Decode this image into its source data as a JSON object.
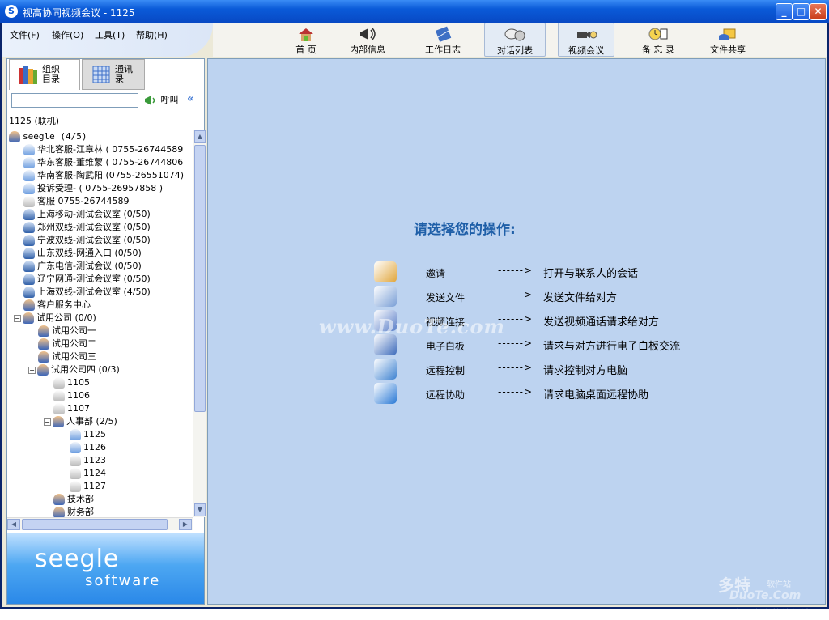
{
  "window": {
    "title": "视高协同视频会议 - 1125",
    "app_icon": "S"
  },
  "menu": {
    "items": [
      "文件(F)",
      "操作(O)",
      "工具(T)",
      "帮助(H)"
    ]
  },
  "toolbar": {
    "items": [
      {
        "label": "首 页",
        "icon": "house-icon"
      },
      {
        "label": "内部信息",
        "icon": "megaphone-icon"
      },
      {
        "label": "工作日志",
        "icon": "notebook-icon"
      },
      {
        "label": "对话列表",
        "icon": "chat-list-icon",
        "active": true
      },
      {
        "label": "视频会议",
        "icon": "video-camera-icon",
        "active": true
      },
      {
        "label": "备 忘 录",
        "icon": "memo-clock-icon"
      },
      {
        "label": "文件共享",
        "icon": "file-share-icon"
      }
    ]
  },
  "left_panel": {
    "tabs": [
      {
        "label": "组织目录",
        "icon": "books-icon"
      },
      {
        "label": "通讯录",
        "icon": "grid-icon"
      }
    ],
    "search": {
      "value": "",
      "placeholder": ""
    },
    "call_button": "呼叫",
    "status": "1125 (联机)",
    "tree": [
      {
        "label": "seegle (4/5)",
        "icon": "group",
        "level": 0,
        "mono": true
      },
      {
        "label": "华北客服-江章林 ( 0755-26744589",
        "icon": "person",
        "level": 1
      },
      {
        "label": "华东客服-董维蒙 ( 0755-26744806",
        "icon": "person",
        "level": 1
      },
      {
        "label": "华南客服-陶武阳 (0755-26551074)",
        "icon": "person",
        "level": 1
      },
      {
        "label": "投诉受理- ( 0755-26957858 )",
        "icon": "person",
        "level": 1
      },
      {
        "label": "客服  0755-26744589",
        "icon": "person-off",
        "level": 1
      },
      {
        "label": "上海移动-测试会议室 (0/50)",
        "icon": "room",
        "level": 1
      },
      {
        "label": "郑州双线-测试会议室 (0/50)",
        "icon": "room",
        "level": 1
      },
      {
        "label": "宁波双线-测试会议室 (0/50)",
        "icon": "room",
        "level": 1
      },
      {
        "label": "山东双线-网通入口 (0/50)",
        "icon": "room",
        "level": 1
      },
      {
        "label": "广东电信-测试会议 (0/50)",
        "icon": "room",
        "level": 1
      },
      {
        "label": "辽宁网通-测试会议室 (0/50)",
        "icon": "room",
        "level": 1
      },
      {
        "label": "上海双线-测试会议室 (4/50)",
        "icon": "room",
        "level": 1
      },
      {
        "label": "客户服务中心",
        "icon": "group",
        "level": 1
      },
      {
        "label": "试用公司 (0/0)",
        "icon": "group",
        "level": 1,
        "expander": "−"
      },
      {
        "label": "试用公司一",
        "icon": "group",
        "level": 2
      },
      {
        "label": "试用公司二",
        "icon": "group",
        "level": 2
      },
      {
        "label": "试用公司三",
        "icon": "group",
        "level": 2
      },
      {
        "label": "试用公司四 (0/3)",
        "icon": "group",
        "level": 2,
        "expander": "−"
      },
      {
        "label": "1105",
        "icon": "person-off",
        "level": 3
      },
      {
        "label": "1106",
        "icon": "person-off",
        "level": 3
      },
      {
        "label": "1107",
        "icon": "person-off",
        "level": 3
      },
      {
        "label": "人事部 (2/5)",
        "icon": "group",
        "level": 3,
        "expander": "−"
      },
      {
        "label": "1125",
        "icon": "person",
        "level": 4
      },
      {
        "label": "1126",
        "icon": "person",
        "level": 4
      },
      {
        "label": "1123",
        "icon": "person-off",
        "level": 4
      },
      {
        "label": "1124",
        "icon": "person-off",
        "level": 4
      },
      {
        "label": "1127",
        "icon": "person-off",
        "level": 4
      },
      {
        "label": "技术部",
        "icon": "group",
        "level": 3
      },
      {
        "label": "财务部",
        "icon": "group",
        "level": 3
      }
    ],
    "logo": {
      "line1": "seegle",
      "line2": "software"
    }
  },
  "main": {
    "prompt": "请选择您的操作:",
    "actions": [
      {
        "name": "邀请",
        "arrow": "------>",
        "desc": "打开与联系人的会话",
        "icon": "invite-icon",
        "color": "#e0a53a"
      },
      {
        "name": "发送文件",
        "arrow": "------>",
        "desc": "发送文件给对方",
        "icon": "send-file-icon",
        "color": "#7a9fd6"
      },
      {
        "name": "视频连接",
        "arrow": "------>",
        "desc": "发送视频通话请求给对方",
        "icon": "webcam-icon",
        "color": "#5b7fc8"
      },
      {
        "name": "电子白板",
        "arrow": "------>",
        "desc": "请求与对方进行电子白板交流",
        "icon": "whiteboard-icon",
        "color": "#3d6bbb"
      },
      {
        "name": "远程控制",
        "arrow": "------>",
        "desc": "请求控制对方电脑",
        "icon": "remote-control-icon",
        "color": "#3f83d1"
      },
      {
        "name": "远程协助",
        "arrow": "------>",
        "desc": "请求电脑桌面远程协助",
        "icon": "remote-assist-icon",
        "color": "#2b7ad6"
      }
    ],
    "watermark": {
      "text": "www.DuoTe.com",
      "brand": "多特",
      "brand_sub": "软件站",
      "brand_en": "DuoTe.Com",
      "tagline": "国内最安全的软件站"
    }
  }
}
